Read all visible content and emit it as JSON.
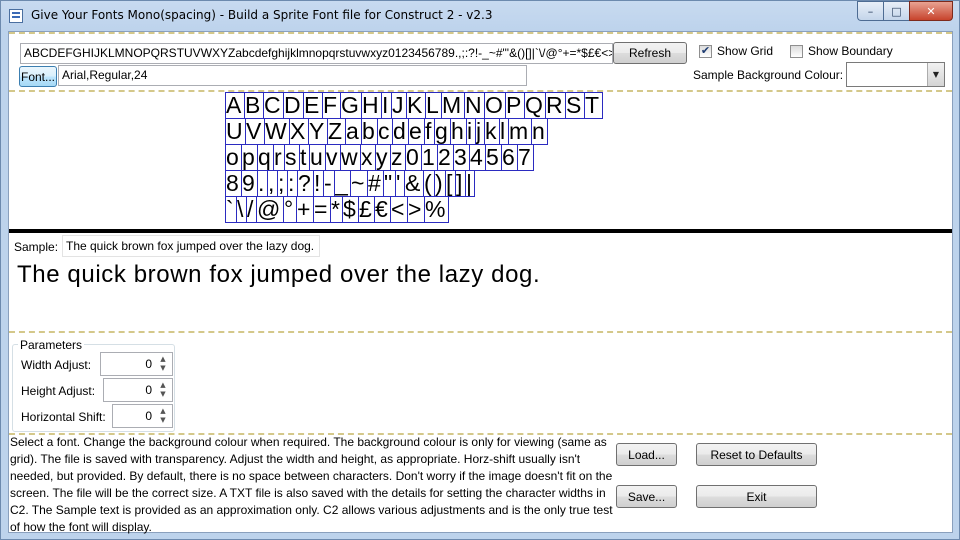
{
  "window": {
    "title": "Give Your Fonts Mono(spacing) - Build a Sprite Font file for Construct 2 - v2.3",
    "controls": {
      "minimize": "–",
      "maximize": "□",
      "close": "✕"
    }
  },
  "toolbar": {
    "charset": "ABCDEFGHIJKLMNOPQRSTUVWXYZabcdefghijklmnopqrstuvwxyz0123456789.,;:?!-_~#\"'&()[]|`\\/@°+=*$£€<>%",
    "refresh_label": "Refresh",
    "show_grid_label": "Show Grid",
    "show_grid_checked": true,
    "show_boundary_label": "Show Boundary",
    "show_boundary_checked": false,
    "font_button_label": "Font...",
    "font_value": "Arial,Regular,24",
    "bg_colour_label": "Sample Background Colour:",
    "bg_colour_value": ""
  },
  "glyph_grid": {
    "rows": [
      [
        "A",
        "B",
        "C",
        "D",
        "E",
        "F",
        "G",
        "H",
        "I",
        "J",
        "K",
        "L",
        "M",
        "N",
        "O",
        "P",
        "Q",
        "R",
        "S",
        "T"
      ],
      [
        "U",
        "V",
        "W",
        "X",
        "Y",
        "Z",
        "a",
        "b",
        "c",
        "d",
        "e",
        "f",
        "g",
        "h",
        "i",
        "j",
        "k",
        "l",
        "m",
        "n"
      ],
      [
        "o",
        "p",
        "q",
        "r",
        "s",
        "t",
        "u",
        "v",
        "w",
        "x",
        "y",
        "z",
        "0",
        "1",
        "2",
        "3",
        "4",
        "5",
        "6",
        "7"
      ],
      [
        "8",
        "9",
        ".",
        ",",
        ";",
        ":",
        "?",
        "!",
        "-",
        "_",
        "~",
        "#",
        "\"",
        "'",
        "&",
        "(",
        ")",
        "[",
        "]",
        "|"
      ],
      [
        "`",
        "\\",
        "/",
        "@",
        "°",
        "+",
        "=",
        "*",
        "$",
        "£",
        "€",
        "<",
        ">",
        "%"
      ]
    ]
  },
  "sample": {
    "label": "Sample:",
    "text": "The quick brown fox jumped over the lazy dog."
  },
  "parameters": {
    "title": "Parameters",
    "width_adjust_label": "Width Adjust:",
    "width_adjust_value": "0",
    "height_adjust_label": "Height Adjust:",
    "height_adjust_value": "0",
    "horizontal_shift_label": "Horizontal Shift:",
    "horizontal_shift_value": "0"
  },
  "help_text": "Select a font. Change the background colour when required. The background colour is only for viewing (same as grid). The file is saved with transparency. Adjust the width and height, as appropriate. Horz-shift usually isn't needed, but provided. By default, there is no space between characters. Don't worry if the image doesn't fit on the screen. The file will be the correct size. A TXT file is also saved with the details for setting the character widths in C2. The Sample text is provided as an approximation only. C2 allows various adjustments and is the only true test of how the font will display.",
  "actions": {
    "load_label": "Load...",
    "reset_label": "Reset to Defaults",
    "save_label": "Save...",
    "exit_label": "Exit"
  }
}
